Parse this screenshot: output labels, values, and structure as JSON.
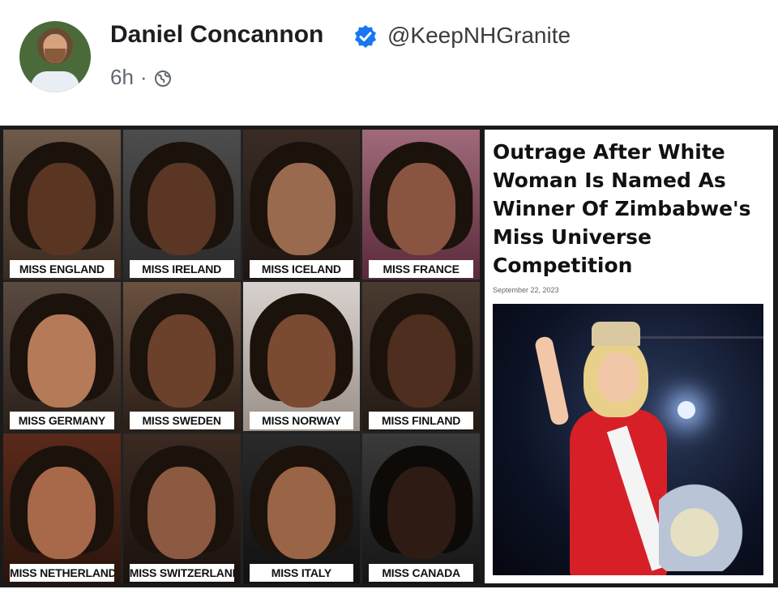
{
  "post": {
    "author_name": "Daniel Concannon",
    "handle": "@KeepNHGranite",
    "time": "6h",
    "separator": "·",
    "icons": {
      "verified": "verified-badge-icon",
      "audience": "globe-icon"
    },
    "accent_color": "#1877f2"
  },
  "collage": {
    "contestants": [
      {
        "label": "MISS ENGLAND"
      },
      {
        "label": "MISS IRELAND"
      },
      {
        "label": "MISS ICELAND"
      },
      {
        "label": "MISS FRANCE"
      },
      {
        "label": "MISS GERMANY"
      },
      {
        "label": "MISS SWEDEN"
      },
      {
        "label": "MISS NORWAY"
      },
      {
        "label": "MISS FINLAND"
      },
      {
        "label": "MISS NETHERLANDS"
      },
      {
        "label": "MISS SWITZERLAND"
      },
      {
        "label": "MISS ITALY"
      },
      {
        "label": "MISS CANADA"
      }
    ]
  },
  "article": {
    "headline": "Outrage After White Woman Is Named As Winner Of Zimbabwe's Miss Universe Competition",
    "date": "September 22, 2023"
  }
}
